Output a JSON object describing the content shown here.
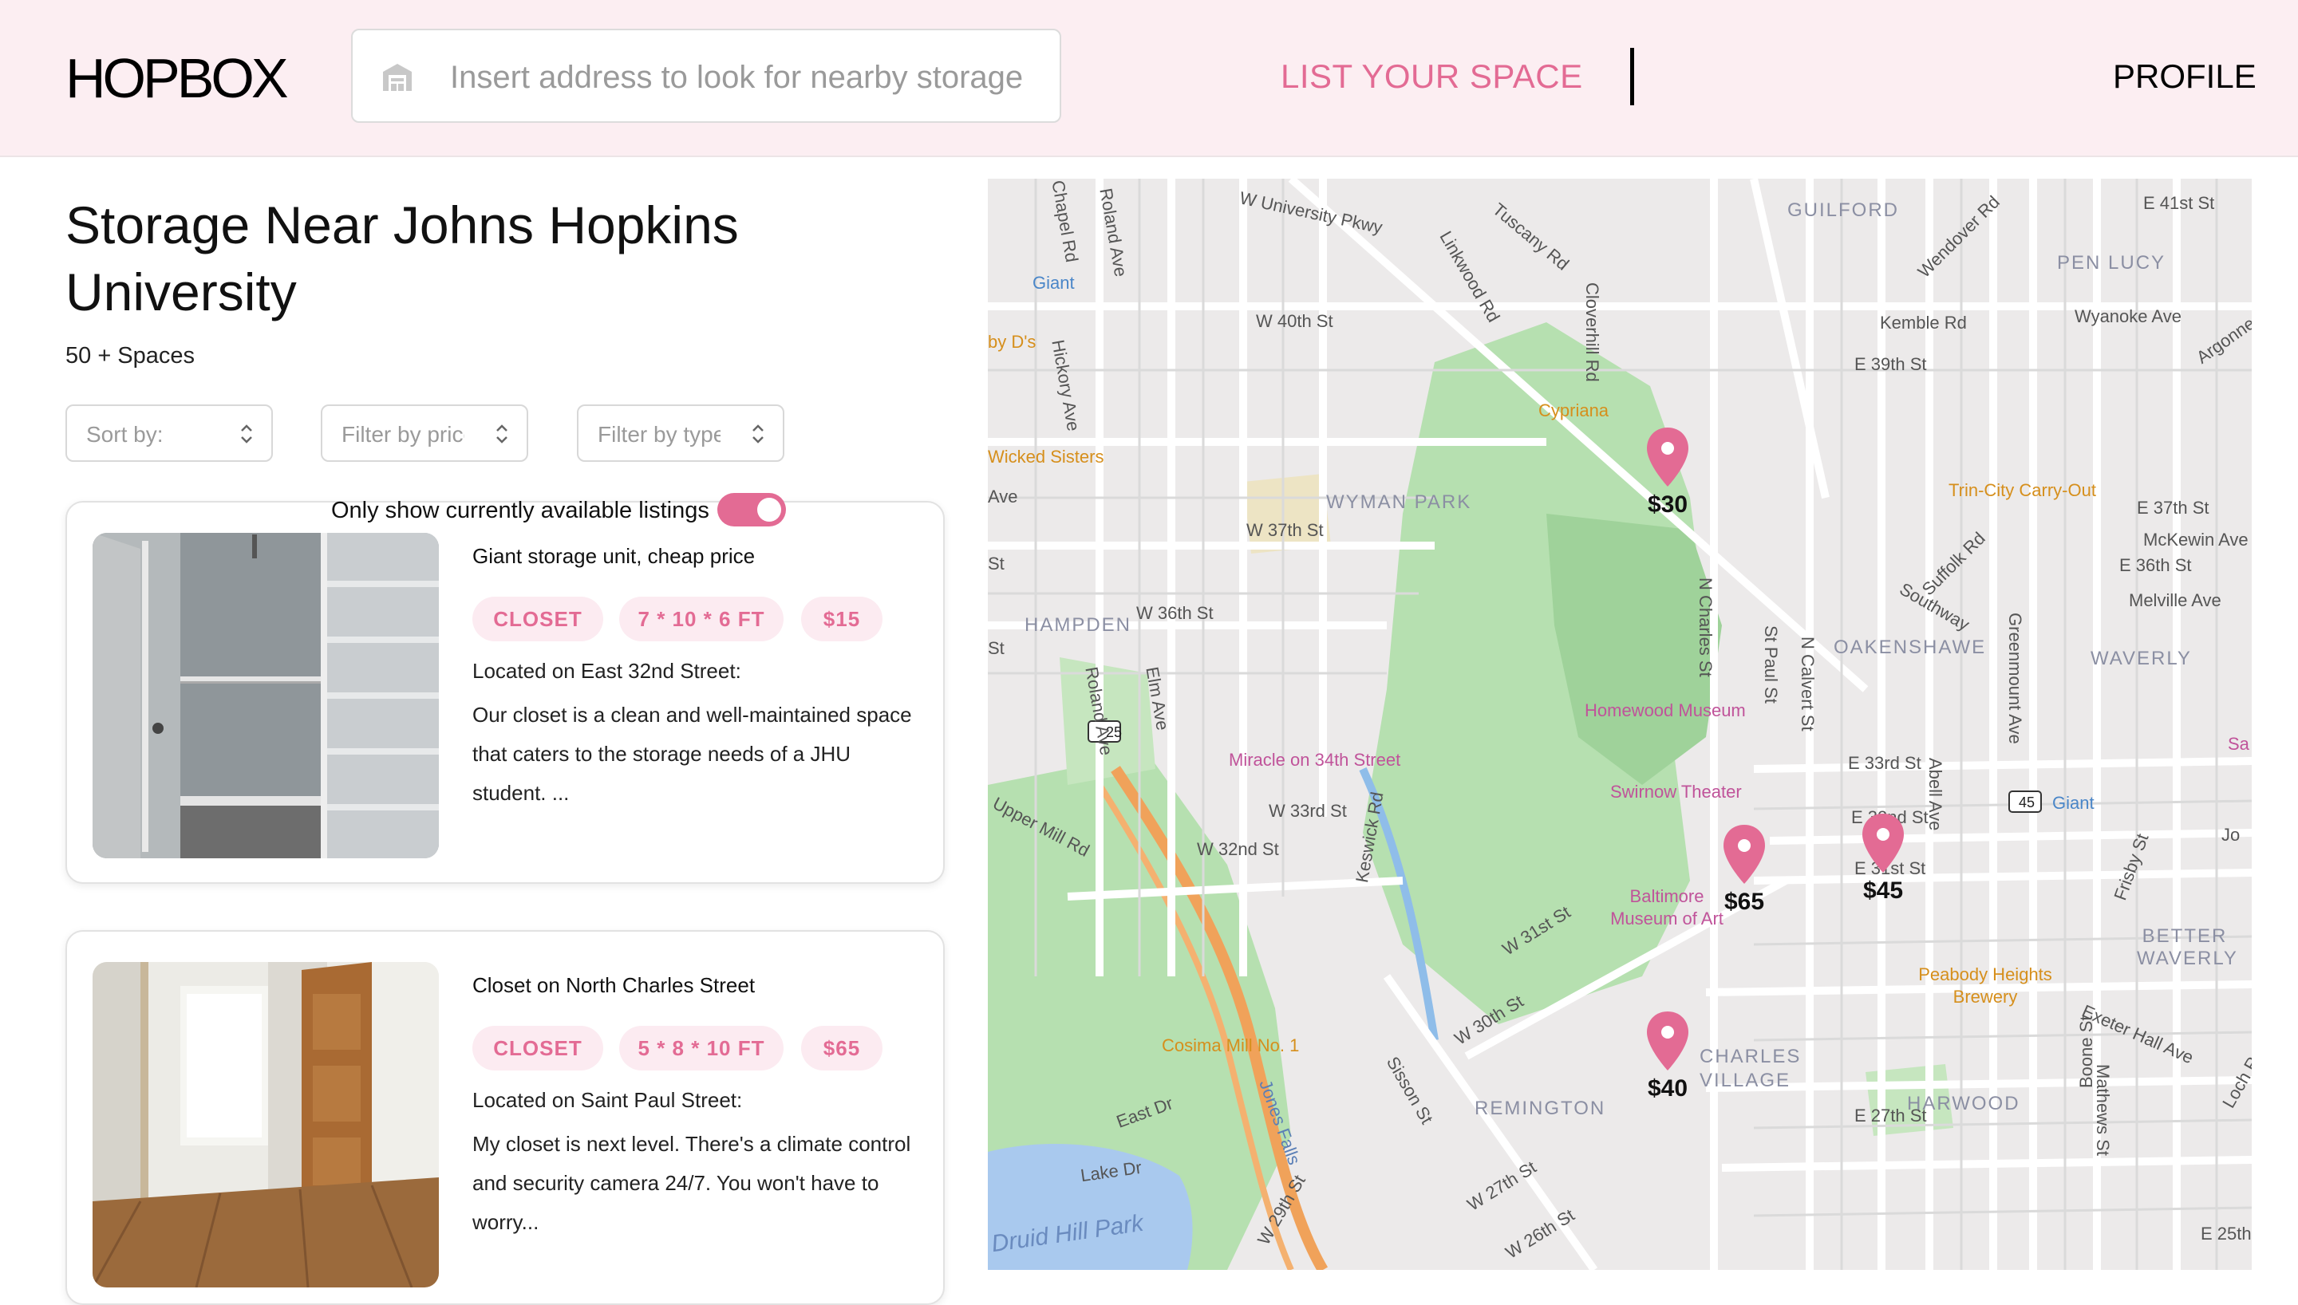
{
  "header": {
    "logo": "HOPBOX",
    "search_placeholder": "Insert address to look for nearby storage",
    "list_space": "LIST YOUR SPACE",
    "profile": "PROFILE"
  },
  "page": {
    "title": "Storage Near Johns Hopkins University",
    "count": "50 + Spaces"
  },
  "filters": [
    {
      "label": "Sort by:"
    },
    {
      "label": "Filter by price"
    },
    {
      "label": "Filter by type"
    }
  ],
  "toggle": {
    "label": "Only show currently available listings",
    "on": true
  },
  "listings": [
    {
      "title": "Giant storage unit, cheap price",
      "type": "CLOSET",
      "size": "7 * 10 * 6 FT",
      "price": "$15",
      "location": "Located on East 32nd Street:",
      "description": "Our closet is a clean and well-maintained space that caters to the storage needs of a JHU student. ..."
    },
    {
      "title": "Closet on North Charles Street",
      "type": "CLOSET",
      "size": "5 * 8 * 10 FT",
      "price": "$65",
      "location": "Located on Saint Paul Street:",
      "description": "My closet is next level. There's a climate control and security camera 24/7. You won't have to worry..."
    }
  ],
  "map": {
    "pins": [
      "$30",
      "$65",
      "$45",
      "$40"
    ],
    "labels": {
      "guilford": "GUILFORD",
      "pen_lucy": "PEN LUCY",
      "wyman_park": "WYMAN PARK",
      "hampden": "HAMPDEN",
      "oakenshawe": "OAKENSHAWE",
      "waverly": "WAVERLY",
      "better_waverly": "BETTER WAVERLY",
      "remington": "REMINGTON",
      "charles_village": "CHARLES VILLAGE",
      "harwood": "HARWOOD",
      "w_40th": "W 40th St",
      "w_37th": "W 37th St",
      "w_36th": "W 36th St",
      "w_33rd": "W 33rd St",
      "w_32nd": "W 32nd St",
      "e_33rd": "E 33rd St",
      "e_32nd": "E 32nd St",
      "e_31st": "E 31st St",
      "e_39th": "E 39th St",
      "e_41st": "E 41st St",
      "e_37th": "E 37th St",
      "e_36th": "E 36th St",
      "e_27th": "E 27th St",
      "e_25th": "E 25th",
      "mckewin": "McKewin Ave",
      "melville": "Melville Ave",
      "kemble": "Kemble Rd",
      "wyanoke": "Wyanoke Ave",
      "w_university": "W University Pkwy",
      "tuscany": "Tuscany Rd",
      "linkwood": "Linkwood Rd",
      "cloverhill": "Cloverhill Rd",
      "wendover": "Wendover Rd",
      "chapel": "Chapel Rd",
      "roland": "Roland Ave",
      "roland2": "Roland Ave",
      "hickory": "Hickory Ave",
      "elm": "Elm Ave",
      "keswick": "Keswick Rd",
      "sisson": "Sisson St",
      "n_charles": "N Charles St",
      "st_paul": "St Paul St",
      "n_calvert": "N Calvert St",
      "abell": "Abell Ave",
      "greenmount": "Greenmount Ave",
      "frisby": "Frisby St",
      "boone": "Boone St",
      "mathews": "Mathews St",
      "suffolk": "Suffolk Rd",
      "southway": "Southway",
      "argonne": "Argonne",
      "exeter": "Exeter Hall Ave",
      "loch": "Loch R",
      "w_31st": "W 31st St",
      "w_30th": "W 30th St",
      "w_27th": "W 27th St",
      "w_26th": "W 26th St",
      "w_29th": "W 29th St",
      "east_dr": "East Dr",
      "lake_dr": "Lake Dr",
      "jones_falls": "Jones Falls",
      "upper_mill": "Upper Mill Rd",
      "ave_cut": "Ave",
      "st_cut": "St",
      "st_cut2": "St",
      "by_d": "by D's",
      "cypriana": "Cypriana",
      "wicked": "Wicked Sisters",
      "trin": "Trin-City Carry-Out",
      "homewood": "Homewood Museum",
      "miracle": "Miracle on 34th Street",
      "swirnow": "Swirnow Theater",
      "bma": "Baltimore Museum of Art",
      "peabody": "Peabody Heights Brewery",
      "cosima": "Cosima Mill No. 1",
      "giant1": "Giant",
      "giant2": "Giant",
      "druid": "Druid Hill Park",
      "sa": "Sa",
      "jc": "Jo",
      "route25": "25",
      "route45": "45"
    }
  }
}
